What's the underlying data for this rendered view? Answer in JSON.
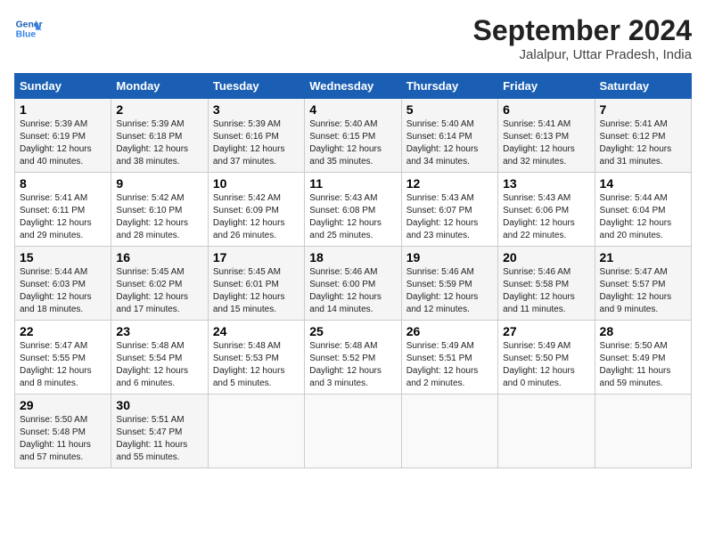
{
  "header": {
    "logo_line1": "General",
    "logo_line2": "Blue",
    "month_title": "September 2024",
    "location": "Jalalpur, Uttar Pradesh, India"
  },
  "weekdays": [
    "Sunday",
    "Monday",
    "Tuesday",
    "Wednesday",
    "Thursday",
    "Friday",
    "Saturday"
  ],
  "weeks": [
    [
      {
        "day": "1",
        "sunrise": "5:39 AM",
        "sunset": "6:19 PM",
        "daylight": "12 hours and 40 minutes."
      },
      {
        "day": "2",
        "sunrise": "5:39 AM",
        "sunset": "6:18 PM",
        "daylight": "12 hours and 38 minutes."
      },
      {
        "day": "3",
        "sunrise": "5:39 AM",
        "sunset": "6:16 PM",
        "daylight": "12 hours and 37 minutes."
      },
      {
        "day": "4",
        "sunrise": "5:40 AM",
        "sunset": "6:15 PM",
        "daylight": "12 hours and 35 minutes."
      },
      {
        "day": "5",
        "sunrise": "5:40 AM",
        "sunset": "6:14 PM",
        "daylight": "12 hours and 34 minutes."
      },
      {
        "day": "6",
        "sunrise": "5:41 AM",
        "sunset": "6:13 PM",
        "daylight": "12 hours and 32 minutes."
      },
      {
        "day": "7",
        "sunrise": "5:41 AM",
        "sunset": "6:12 PM",
        "daylight": "12 hours and 31 minutes."
      }
    ],
    [
      {
        "day": "8",
        "sunrise": "5:41 AM",
        "sunset": "6:11 PM",
        "daylight": "12 hours and 29 minutes."
      },
      {
        "day": "9",
        "sunrise": "5:42 AM",
        "sunset": "6:10 PM",
        "daylight": "12 hours and 28 minutes."
      },
      {
        "day": "10",
        "sunrise": "5:42 AM",
        "sunset": "6:09 PM",
        "daylight": "12 hours and 26 minutes."
      },
      {
        "day": "11",
        "sunrise": "5:43 AM",
        "sunset": "6:08 PM",
        "daylight": "12 hours and 25 minutes."
      },
      {
        "day": "12",
        "sunrise": "5:43 AM",
        "sunset": "6:07 PM",
        "daylight": "12 hours and 23 minutes."
      },
      {
        "day": "13",
        "sunrise": "5:43 AM",
        "sunset": "6:06 PM",
        "daylight": "12 hours and 22 minutes."
      },
      {
        "day": "14",
        "sunrise": "5:44 AM",
        "sunset": "6:04 PM",
        "daylight": "12 hours and 20 minutes."
      }
    ],
    [
      {
        "day": "15",
        "sunrise": "5:44 AM",
        "sunset": "6:03 PM",
        "daylight": "12 hours and 18 minutes."
      },
      {
        "day": "16",
        "sunrise": "5:45 AM",
        "sunset": "6:02 PM",
        "daylight": "12 hours and 17 minutes."
      },
      {
        "day": "17",
        "sunrise": "5:45 AM",
        "sunset": "6:01 PM",
        "daylight": "12 hours and 15 minutes."
      },
      {
        "day": "18",
        "sunrise": "5:46 AM",
        "sunset": "6:00 PM",
        "daylight": "12 hours and 14 minutes."
      },
      {
        "day": "19",
        "sunrise": "5:46 AM",
        "sunset": "5:59 PM",
        "daylight": "12 hours and 12 minutes."
      },
      {
        "day": "20",
        "sunrise": "5:46 AM",
        "sunset": "5:58 PM",
        "daylight": "12 hours and 11 minutes."
      },
      {
        "day": "21",
        "sunrise": "5:47 AM",
        "sunset": "5:57 PM",
        "daylight": "12 hours and 9 minutes."
      }
    ],
    [
      {
        "day": "22",
        "sunrise": "5:47 AM",
        "sunset": "5:55 PM",
        "daylight": "12 hours and 8 minutes."
      },
      {
        "day": "23",
        "sunrise": "5:48 AM",
        "sunset": "5:54 PM",
        "daylight": "12 hours and 6 minutes."
      },
      {
        "day": "24",
        "sunrise": "5:48 AM",
        "sunset": "5:53 PM",
        "daylight": "12 hours and 5 minutes."
      },
      {
        "day": "25",
        "sunrise": "5:48 AM",
        "sunset": "5:52 PM",
        "daylight": "12 hours and 3 minutes."
      },
      {
        "day": "26",
        "sunrise": "5:49 AM",
        "sunset": "5:51 PM",
        "daylight": "12 hours and 2 minutes."
      },
      {
        "day": "27",
        "sunrise": "5:49 AM",
        "sunset": "5:50 PM",
        "daylight": "12 hours and 0 minutes."
      },
      {
        "day": "28",
        "sunrise": "5:50 AM",
        "sunset": "5:49 PM",
        "daylight": "11 hours and 59 minutes."
      }
    ],
    [
      {
        "day": "29",
        "sunrise": "5:50 AM",
        "sunset": "5:48 PM",
        "daylight": "11 hours and 57 minutes."
      },
      {
        "day": "30",
        "sunrise": "5:51 AM",
        "sunset": "5:47 PM",
        "daylight": "11 hours and 55 minutes."
      },
      null,
      null,
      null,
      null,
      null
    ]
  ]
}
